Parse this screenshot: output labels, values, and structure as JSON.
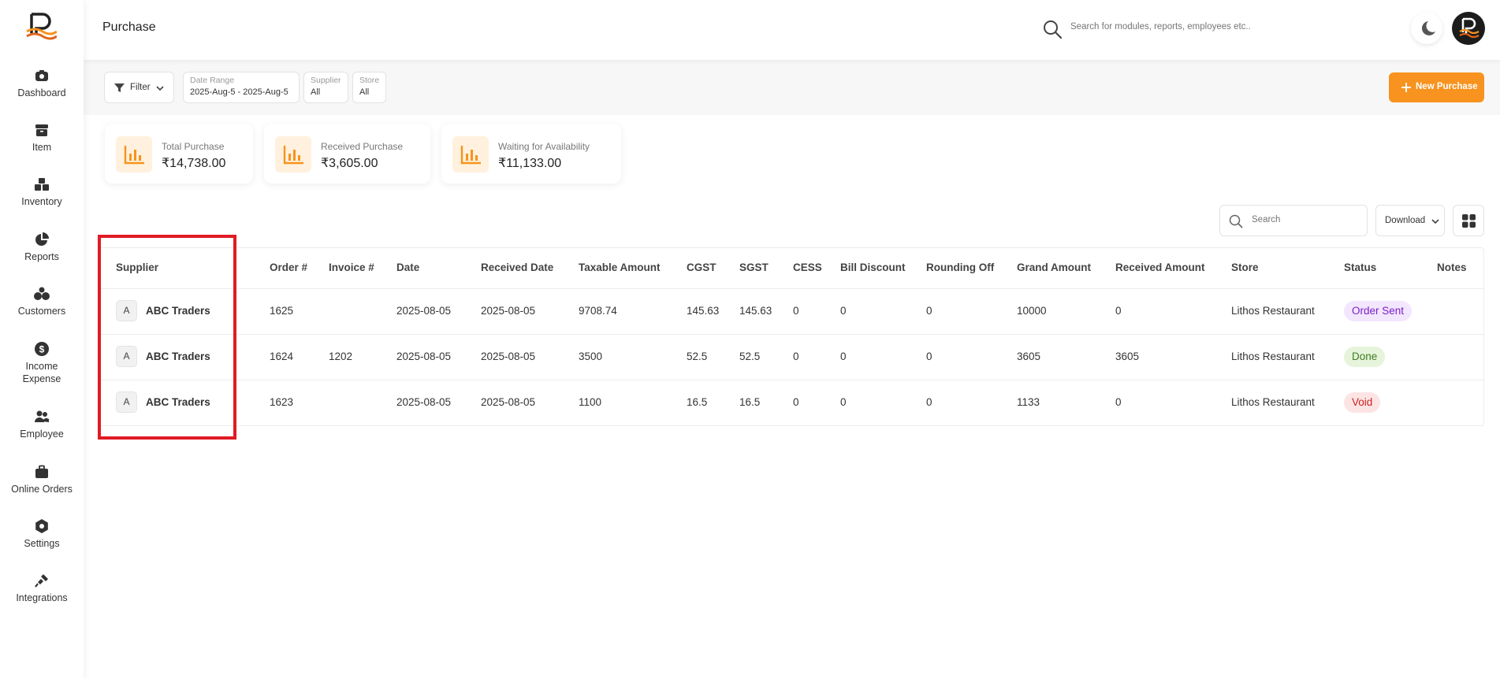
{
  "sidebar": {
    "items": [
      {
        "label": "Dashboard",
        "icon": "camera-icon"
      },
      {
        "label": "Item",
        "icon": "archive-box-icon"
      },
      {
        "label": "Inventory",
        "icon": "boxes-icon"
      },
      {
        "label": "Reports",
        "icon": "pie-chart-icon"
      },
      {
        "label": "Customers",
        "icon": "users-icon"
      },
      {
        "label": "Income Expense",
        "icon": "dollar-icon"
      },
      {
        "label": "Employee",
        "icon": "employee-icon"
      },
      {
        "label": "Online Orders",
        "icon": "briefcase-icon"
      },
      {
        "label": "Settings",
        "icon": "gear-icon"
      },
      {
        "label": "Integrations",
        "icon": "plug-icon"
      }
    ]
  },
  "header": {
    "title": "Purchase",
    "search_placeholder": "Search for modules, reports, employees etc.."
  },
  "filters": {
    "filter_label": "Filter",
    "date_range_label": "Date Range",
    "date_range_value": "2025-Aug-5 - 2025-Aug-5",
    "supplier_label": "Supplier",
    "supplier_value": "All",
    "store_label": "Store",
    "store_value": "All",
    "new_purchase_label": "New Purchase"
  },
  "stats": [
    {
      "label": "Total Purchase",
      "value": "₹14,738.00"
    },
    {
      "label": "Received Purchase",
      "value": "₹3,605.00"
    },
    {
      "label": "Waiting for Availability",
      "value": "₹11,133.00"
    }
  ],
  "toolbar": {
    "search_placeholder": "Search",
    "download_label": "Download"
  },
  "table": {
    "headers": [
      "Supplier",
      "Order #",
      "Invoice #",
      "Date",
      "Received Date",
      "Taxable Amount",
      "CGST",
      "SGST",
      "CESS",
      "Bill Discount",
      "Rounding Off",
      "Grand Amount",
      "Received Amount",
      "Store",
      "Status",
      "Notes"
    ],
    "rows": [
      {
        "avatar": "A",
        "supplier": "ABC Traders",
        "order": "1625",
        "invoice": "",
        "date": "2025-08-05",
        "received_date": "2025-08-05",
        "taxable": "9708.74",
        "cgst": "145.63",
        "sgst": "145.63",
        "cess": "0",
        "bill_discount": "0",
        "rounding": "0",
        "grand": "10000",
        "received": "0",
        "store": "Lithos Restaurant",
        "status": "Order Sent",
        "notes": ""
      },
      {
        "avatar": "A",
        "supplier": "ABC Traders",
        "order": "1624",
        "invoice": "1202",
        "date": "2025-08-05",
        "received_date": "2025-08-05",
        "taxable": "3500",
        "cgst": "52.5",
        "sgst": "52.5",
        "cess": "0",
        "bill_discount": "0",
        "rounding": "0",
        "grand": "3605",
        "received": "3605",
        "store": "Lithos Restaurant",
        "status": "Done",
        "notes": ""
      },
      {
        "avatar": "A",
        "supplier": "ABC Traders",
        "order": "1623",
        "invoice": "",
        "date": "2025-08-05",
        "received_date": "2025-08-05",
        "taxable": "1100",
        "cgst": "16.5",
        "sgst": "16.5",
        "cess": "0",
        "bill_discount": "0",
        "rounding": "0",
        "grand": "1133",
        "received": "0",
        "store": "Lithos Restaurant",
        "status": "Void",
        "notes": ""
      }
    ]
  },
  "colors": {
    "accent": "#f7931e",
    "highlight": "#e01b24",
    "status_sent": "#7a1fc4",
    "status_done": "#3f7d20",
    "status_void": "#cc1f1f"
  }
}
